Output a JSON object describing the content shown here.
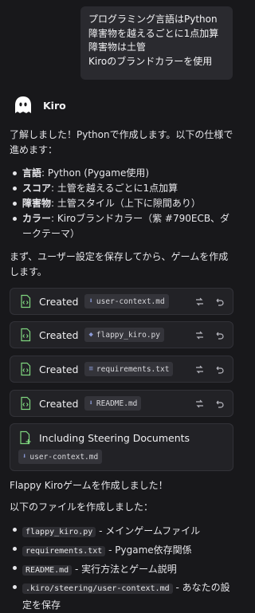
{
  "user_message": {
    "lines": [
      "プログラミング言語はPython",
      "障害物を越えるごとに1点加算",
      "障害物は土管",
      "Kiroのブランドカラーを使用"
    ]
  },
  "assistant": {
    "name": "Kiro",
    "intro": "了解しました！Pythonで作成します。以下の仕様で進めます：",
    "specs": [
      {
        "key": "言語",
        "value": ": Python (Pygame使用)"
      },
      {
        "key": "スコア",
        "value": ": 土管を越えるごとに1点加算"
      },
      {
        "key": "障害物",
        "value": ": 土管スタイル（上下に隙間あり）"
      },
      {
        "key": "カラー",
        "value": ": Kiroブランドカラー（紫 #790ECB、ダークテーマ）"
      }
    ],
    "pre_create_text": "まず、ユーザー設定を保存してから、ゲームを作成します。",
    "created_files": [
      {
        "label": "Created",
        "file": "user-context.md",
        "icon": "markdown-file-icon"
      },
      {
        "label": "Created",
        "file": "flappy_kiro.py",
        "icon": "python-file-icon"
      },
      {
        "label": "Created",
        "file": "requirements.txt",
        "icon": "text-file-icon"
      },
      {
        "label": "Created",
        "file": "README.md",
        "icon": "markdown-file-icon"
      }
    ],
    "steering": {
      "label": "Including Steering Documents",
      "file": "user-context.md"
    },
    "done_text": "Flappy Kiroゲームを作成しました！",
    "files_intro": "以下のファイルを作成しました：",
    "file_summary": [
      {
        "file": "flappy_kiro.py",
        "desc": " - メインゲームファイル"
      },
      {
        "file": "requirements.txt",
        "desc": " - Pygame依存関係"
      },
      {
        "file": "README.md",
        "desc": " - 実行方法とゲーム説明"
      },
      {
        "file": ".kiro/steering/user-context.md",
        "desc": " - あなたの設定を保存"
      }
    ]
  },
  "colors": {
    "background": "#18181b",
    "card": "#222226",
    "accent_green": "#7fd67f",
    "brand_purple": "#790ECB"
  }
}
